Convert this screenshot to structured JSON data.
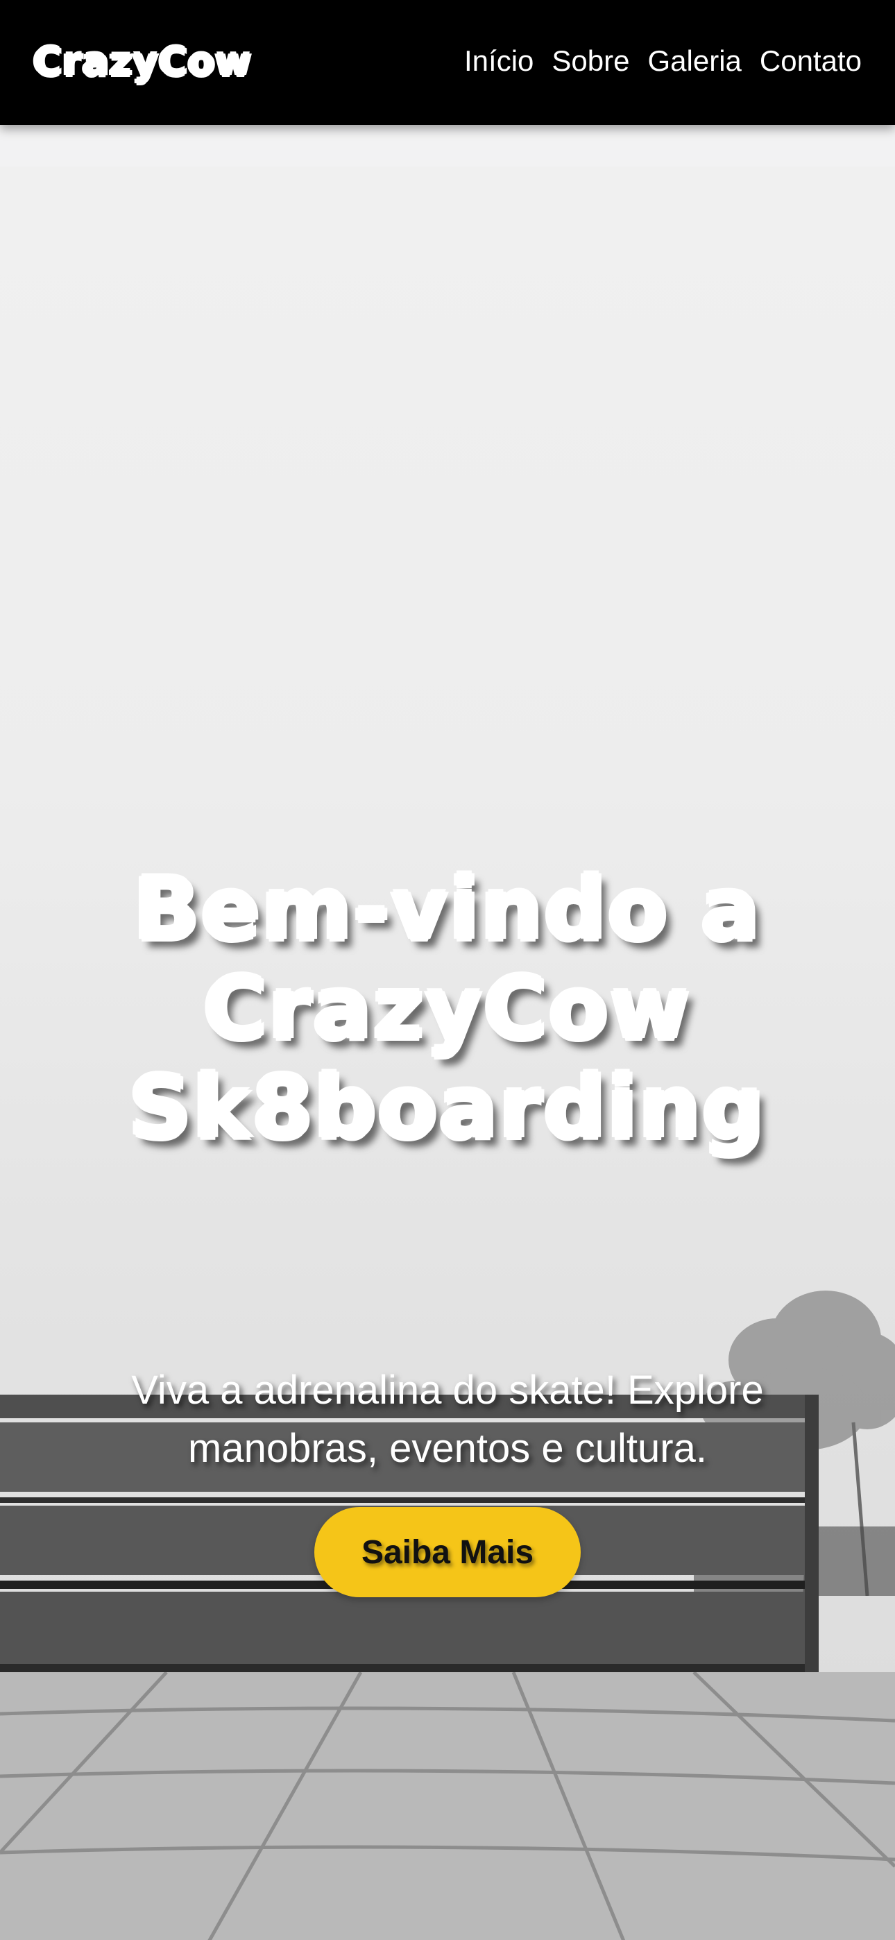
{
  "header": {
    "logo": "CrazyCow",
    "nav": [
      {
        "label": "Início"
      },
      {
        "label": "Sobre"
      },
      {
        "label": "Galeria"
      },
      {
        "label": "Contato"
      }
    ]
  },
  "hero": {
    "title_lines": [
      "Bem-vindo a",
      "CrazyCow",
      "Sk8boarding"
    ],
    "subtitle_lines": [
      "Viva a adrenalina do skate! Explore",
      "manobras, eventos e cultura."
    ],
    "cta_label": "Saiba Mais"
  },
  "colors": {
    "header_bg": "#000000",
    "accent": "#f5c518",
    "text_light": "#ffffff"
  }
}
